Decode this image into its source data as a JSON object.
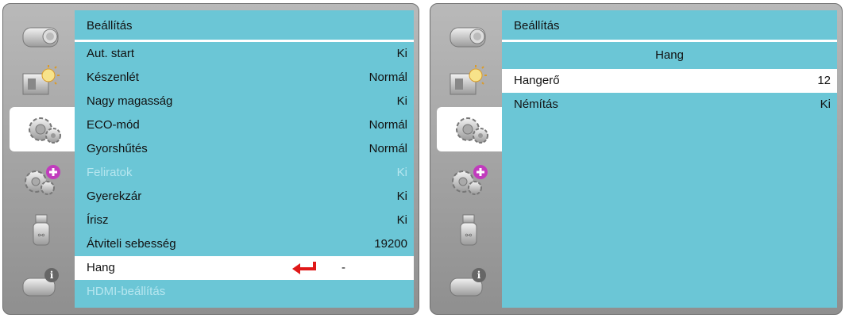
{
  "left_panel": {
    "title": "Beállítás",
    "rows": [
      {
        "label": "Aut. start",
        "value": "Ki"
      },
      {
        "label": "Készenlét",
        "value": "Normál"
      },
      {
        "label": "Nagy magasság",
        "value": "Ki"
      },
      {
        "label": "ECO-mód",
        "value": "Normál"
      },
      {
        "label": "Gyorshűtés",
        "value": "Normál"
      },
      {
        "label": "Feliratok",
        "value": "Ki"
      },
      {
        "label": "Gyerekzár",
        "value": "Ki"
      },
      {
        "label": "Írisz",
        "value": "Ki"
      },
      {
        "label": "Átviteli sebesség",
        "value": "19200"
      },
      {
        "label": "Hang",
        "value": "-"
      },
      {
        "label": "HDMI-beállítás",
        "value": ""
      }
    ]
  },
  "right_panel": {
    "title": "Beállítás",
    "subheader": "Hang",
    "rows": [
      {
        "label": "Hangerő",
        "value": "12"
      },
      {
        "label": "Némítás",
        "value": "Ki"
      }
    ]
  },
  "sidebar_icons": [
    "camera-icon",
    "picture-icon",
    "settings-gears-icon",
    "advanced-settings-icon",
    "usb-icon",
    "info-icon"
  ],
  "colors": {
    "content_bg": "#6bc6d6",
    "selected_bg": "#ffffff",
    "disabled_text": "#b6e6ef",
    "enter_arrow": "#e01818"
  }
}
